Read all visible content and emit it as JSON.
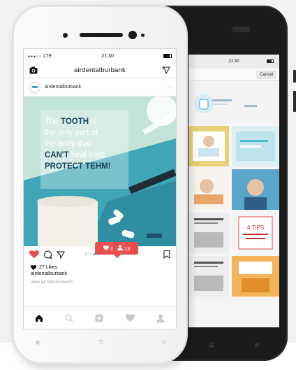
{
  "main_phone": {
    "status": {
      "signal": "●●●○○",
      "carrier": "LTE",
      "time": "21:30"
    },
    "header": {
      "camera_icon": "camera-icon",
      "title": "airdentalburbank",
      "send_icon": "send-icon"
    },
    "post": {
      "username": "airdentalburbank",
      "more": "...",
      "image_text": [
        "The ",
        "TOOTH",
        " is",
        "the only part of",
        "the body that",
        "CAN'T",
        " heal itself.",
        "PROTECT TEHM!"
      ],
      "likes": "27 Likes",
      "caption_owner": "airdentalburbank",
      "comments_link": "view all 12comments"
    },
    "notification": {
      "likes_count": "3",
      "followers_count": "13"
    },
    "tabbar": [
      "home-icon",
      "search-icon",
      "add-icon",
      "activity-icon",
      "profile-icon"
    ]
  },
  "back_phone": {
    "status": {
      "time": "21:30"
    },
    "cancel_label": "Cancel",
    "grid_texts": [
      "4 TIPS"
    ]
  },
  "colors": {
    "accent": "#e5504e",
    "navy": "#16425a",
    "mint": "#bfe0d6",
    "teal": "#4fb8c6"
  }
}
